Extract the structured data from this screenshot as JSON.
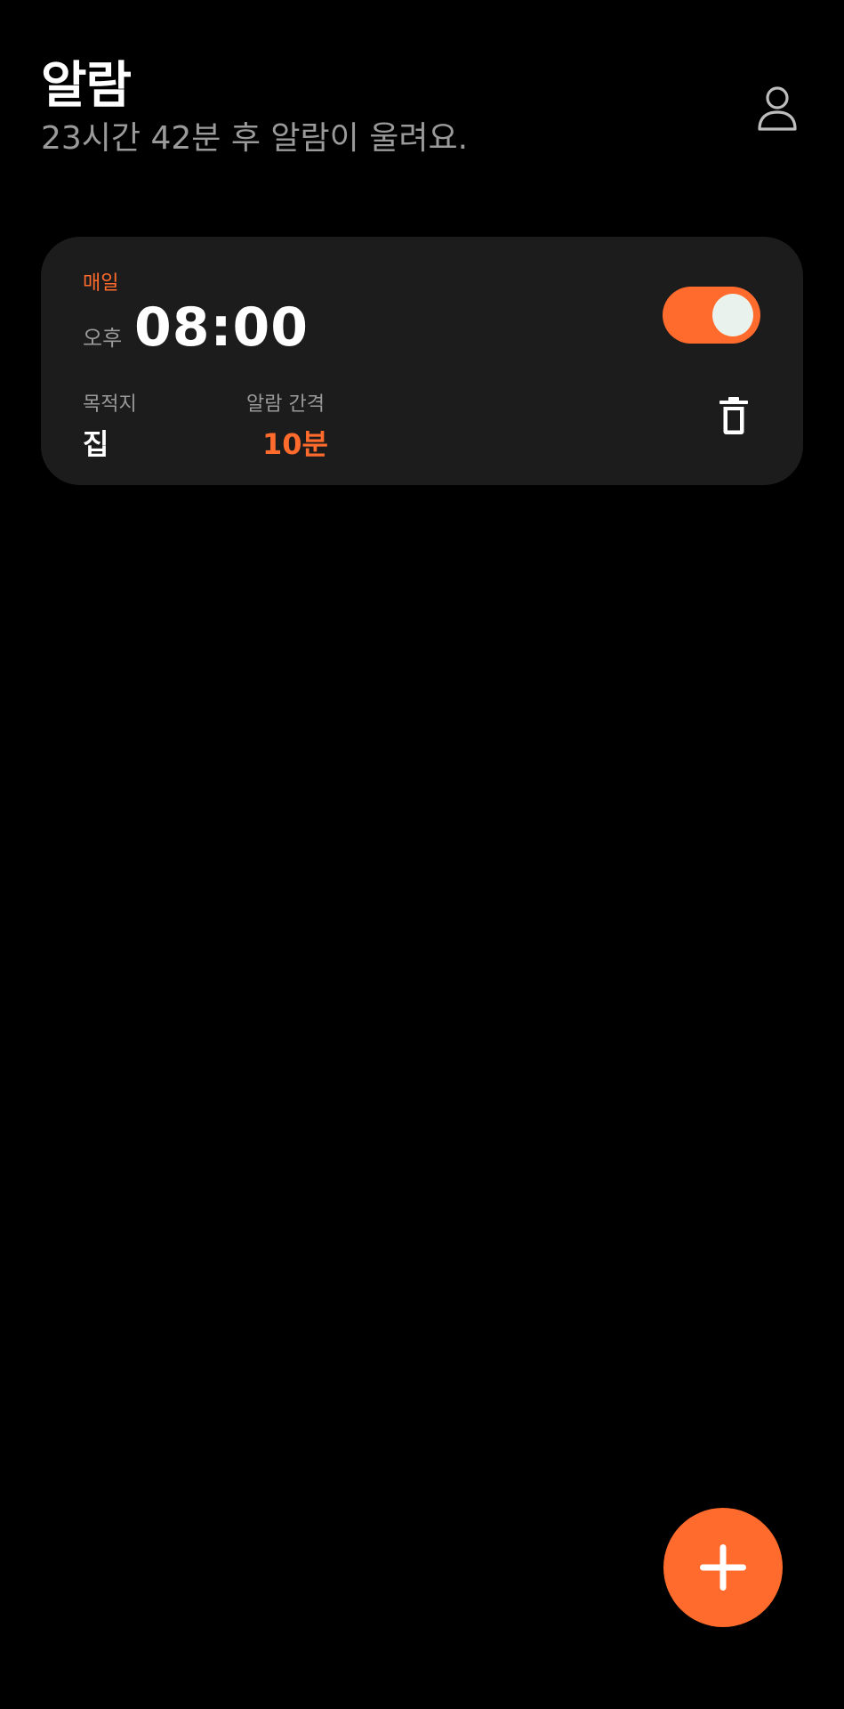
{
  "header": {
    "title": "알람",
    "subtitle": "23시간 42분 후 알람이 울려요.",
    "profile_icon": "user-icon"
  },
  "alarms": [
    {
      "repeat": "매일",
      "ampm": "오후",
      "time": "08:00",
      "enabled": true,
      "destination_label": "목적지",
      "destination_value": "집",
      "interval_label": "알람 간격",
      "interval_value": "10분",
      "delete_icon": "trash-icon"
    }
  ],
  "fab": {
    "icon": "plus-icon"
  },
  "colors": {
    "background": "#000000",
    "card": "#1c1c1c",
    "accent": "#ff6b2c",
    "muted_text": "#9a9a9a",
    "primary_text": "#ffffff",
    "toggle_knob": "#e9f2ec"
  }
}
